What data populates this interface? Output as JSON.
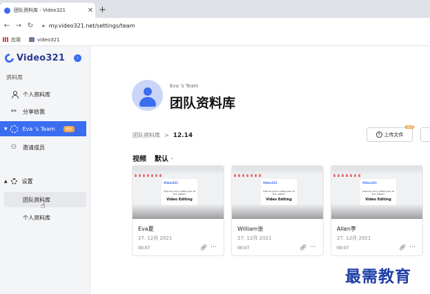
{
  "browser": {
    "tab_title": "团队资料库 - Video321",
    "tab_close": "✕",
    "new_tab": "+",
    "url": "my.video321.net/settings/team",
    "bookmarks": [
      {
        "label": "应用",
        "icon": "apps-icon"
      },
      {
        "label": "video321",
        "icon": "folder-icon"
      }
    ]
  },
  "sidebar": {
    "brand": "Video321",
    "section_label": "资料库",
    "items": [
      {
        "label": "个人资料库",
        "icon": "user-icon"
      },
      {
        "label": "分享给我",
        "icon": "share-icon"
      },
      {
        "label": "Eva 's Team",
        "icon": "team-icon",
        "badge": "团队",
        "active": true
      },
      {
        "label": "邀请成员",
        "icon": "invite-icon"
      }
    ],
    "settings": {
      "label": "设置",
      "subitems": [
        {
          "label": "团队资料库",
          "hover": true
        },
        {
          "label": "个人资料库"
        }
      ]
    }
  },
  "main": {
    "team_name": "Eva 's Team",
    "title": "团队资料库",
    "breadcrumb": {
      "root": "团队资料库",
      "sep": ">",
      "current": "12.14"
    },
    "upload_label": "上传文件",
    "upload_badge": "NEW",
    "section_label": "视频",
    "sort_label": "默认",
    "cards": [
      {
        "name": "Eva夏",
        "date": "27. 12月 2021",
        "duration": "00:07",
        "thumb_logo": "Video321",
        "thumb_question": "How to put a video part of the video?",
        "thumb_title": "Video Editing"
      },
      {
        "name": "William张",
        "date": "27. 12月 2021",
        "duration": "00:07",
        "thumb_logo": "Video321",
        "thumb_question": "How to put a video part of the video?",
        "thumb_title": "Video Editing"
      },
      {
        "name": "Allen李",
        "date": "27. 12月 2021",
        "duration": "00:07",
        "thumb_logo": "Video321",
        "thumb_question": "How to put a video part of the video?",
        "thumb_title": "Video Editing"
      }
    ]
  },
  "watermark": "最需教育",
  "colors": {
    "accent": "#3b6df0",
    "badge": "#f0a24a",
    "watermark": "#1e3ea6"
  }
}
